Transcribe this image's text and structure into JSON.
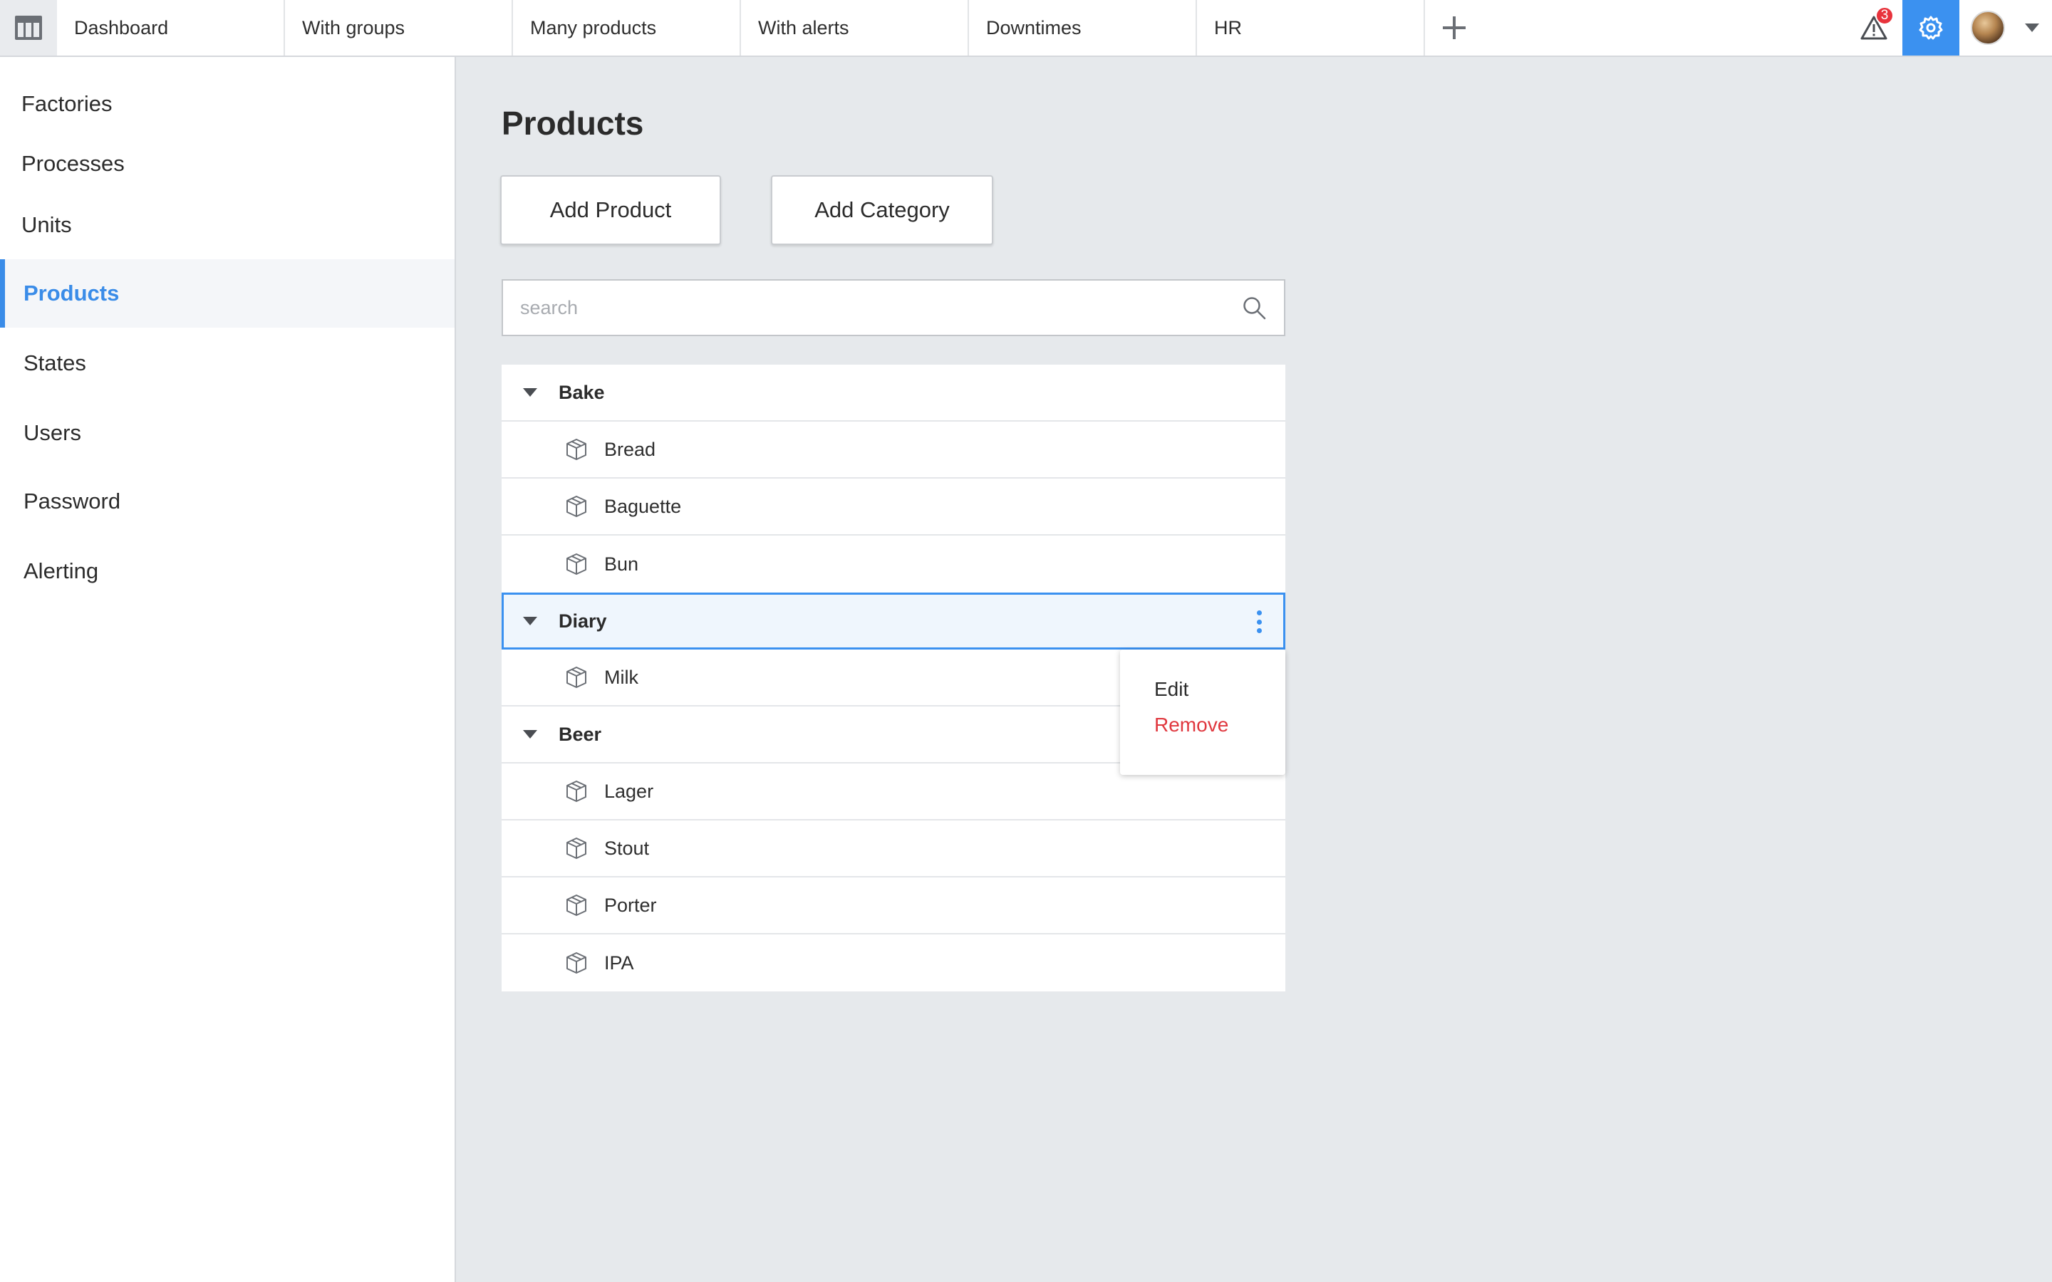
{
  "topbar": {
    "tabs": [
      {
        "label": "Dashboard"
      },
      {
        "label": "With groups"
      },
      {
        "label": "Many products"
      },
      {
        "label": "With alerts"
      },
      {
        "label": "Downtimes"
      },
      {
        "label": "HR"
      }
    ],
    "alert_count": "3",
    "accent_color": "#3b91f0"
  },
  "sidebar": {
    "items": [
      {
        "label": "Factories"
      },
      {
        "label": "Processes"
      },
      {
        "label": "Units"
      },
      {
        "label": "Products",
        "active": true
      },
      {
        "label": "States"
      },
      {
        "label": "Users"
      },
      {
        "label": "Password"
      },
      {
        "label": "Alerting"
      }
    ]
  },
  "main": {
    "title": "Products",
    "add_product_label": "Add Product",
    "add_category_label": "Add Category",
    "search_placeholder": "search",
    "tree": {
      "groups": [
        {
          "name": "Bake",
          "items": [
            "Bread",
            "Baguette",
            "Bun"
          ]
        },
        {
          "name": "Diary",
          "items": [
            "Milk"
          ],
          "selected": true
        },
        {
          "name": "Beer",
          "items": [
            "Lager",
            "Stout",
            "Porter",
            "IPA"
          ]
        }
      ]
    },
    "context_menu": {
      "edit_label": "Edit",
      "remove_label": "Remove",
      "remove_color": "#e0383f"
    }
  }
}
